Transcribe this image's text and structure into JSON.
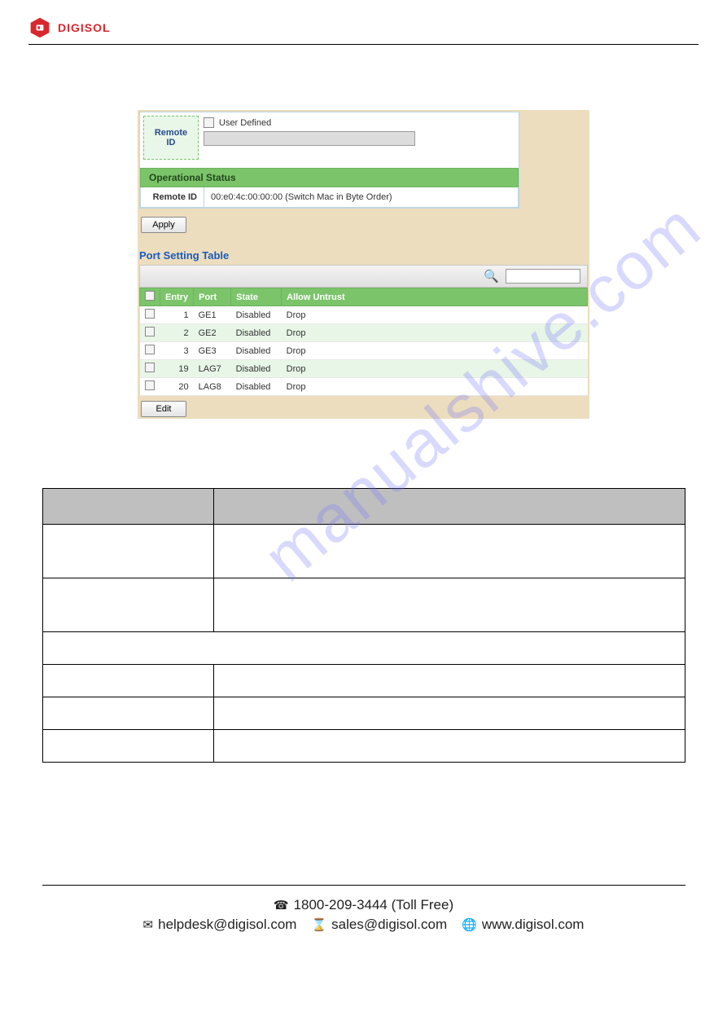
{
  "brand": {
    "name": "DIGISOL"
  },
  "watermark": "manualshive.com",
  "remote_id": {
    "label": "Remote ID",
    "user_defined_label": "User Defined"
  },
  "operational_status": {
    "header": "Operational Status",
    "remote_id_label": "Remote ID",
    "remote_id_value": "00:e0:4c:00:00:00 (Switch Mac in Byte Order)"
  },
  "buttons": {
    "apply": "Apply",
    "edit": "Edit"
  },
  "port_setting": {
    "title": "Port Setting Table",
    "search_placeholder": "",
    "columns": {
      "entry": "Entry",
      "port": "Port",
      "state": "State",
      "allow_untrust": "Allow Untrust"
    },
    "rows": [
      {
        "entry": "1",
        "port": "GE1",
        "state": "Disabled",
        "allow_untrust": "Drop"
      },
      {
        "entry": "2",
        "port": "GE2",
        "state": "Disabled",
        "allow_untrust": "Drop"
      },
      {
        "entry": "3",
        "port": "GE3",
        "state": "Disabled",
        "allow_untrust": "Drop"
      },
      {
        "entry": "19",
        "port": "LAG7",
        "state": "Disabled",
        "allow_untrust": "Drop"
      },
      {
        "entry": "20",
        "port": "LAG8",
        "state": "Disabled",
        "allow_untrust": "Drop"
      }
    ]
  },
  "footer": {
    "toll_free": "1800-209-3444 (Toll Free)",
    "helpdesk": "helpdesk@digisol.com",
    "sales": "sales@digisol.com",
    "web": "www.digisol.com"
  }
}
